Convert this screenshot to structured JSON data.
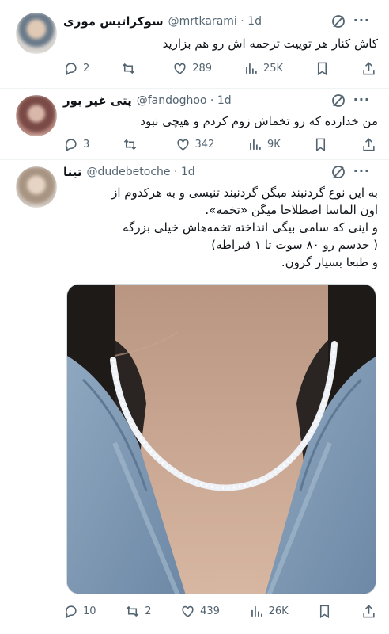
{
  "tweets": [
    {
      "name": "سوکراتیس موری",
      "handle": "@mrtkarami",
      "time": "1d",
      "lines": [
        "کاش کنار هر توییت ترجمه اش رو هم بزارید"
      ],
      "replies": "2",
      "retweets": "",
      "likes": "289",
      "views": "25K"
    },
    {
      "name": "پتی غیر بور",
      "handle": "@fandoghoo",
      "time": "1d",
      "lines": [
        "من خدازده که رو تخماش زوم کردم و هیچی نبود"
      ],
      "replies": "3",
      "retweets": "",
      "likes": "342",
      "views": "9K"
    },
    {
      "name": "تینا",
      "handle": "@dudebetoche",
      "time": "1d",
      "lines": [
        "به این نوع گردنبند میگن گردنبند تنیسی و به هرکدوم از",
        "اون الماسا اصطلاحا میگن «تخمه».",
        "و اینی که سامی بیگی انداخته تخمه‌هاش خیلی بزرگه",
        "( حدسم رو ۸۰ سوت تا ۱ قیراطه)",
        "و طبعا بسیار گرون."
      ],
      "replies": "10",
      "retweets": "2",
      "likes": "439",
      "views": "26K"
    }
  ],
  "colors": {
    "text": "#0f1419",
    "secondary": "#536471",
    "border": "#eff3f4"
  },
  "icons": [
    "reply-icon",
    "retweet-icon",
    "like-icon",
    "views-icon",
    "bookmark-icon",
    "share-icon",
    "grok-icon",
    "more-icon"
  ]
}
